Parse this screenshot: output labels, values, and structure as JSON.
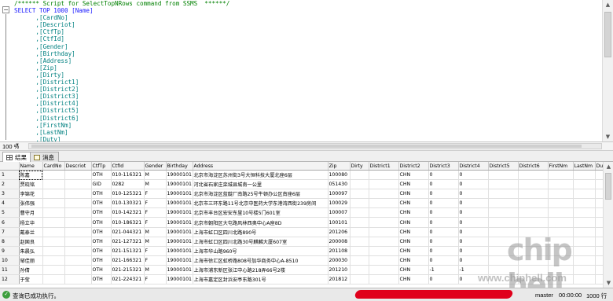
{
  "editor": {
    "lines": [
      {
        "t": "/****** Script for SelectTopNRows command from SSMS  ******/",
        "c": "comment"
      },
      {
        "t": "SELECT TOP 1000 [Name]",
        "c": "kw"
      },
      {
        "t": "      ,[CardNo]",
        "c": "col"
      },
      {
        "t": "      ,[Descriot]",
        "c": "col"
      },
      {
        "t": "      ,[CtfTp]",
        "c": "col"
      },
      {
        "t": "      ,[CtfId]",
        "c": "col"
      },
      {
        "t": "      ,[Gender]",
        "c": "col"
      },
      {
        "t": "      ,[Birthday]",
        "c": "col"
      },
      {
        "t": "      ,[Address]",
        "c": "col"
      },
      {
        "t": "      ,[Zip]",
        "c": "col"
      },
      {
        "t": "      ,[Dirty]",
        "c": "col"
      },
      {
        "t": "      ,[District1]",
        "c": "col"
      },
      {
        "t": "      ,[District2]",
        "c": "col"
      },
      {
        "t": "      ,[District3]",
        "c": "col"
      },
      {
        "t": "      ,[District4]",
        "c": "col"
      },
      {
        "t": "      ,[District5]",
        "c": "col"
      },
      {
        "t": "      ,[District6]",
        "c": "col"
      },
      {
        "t": "      ,[FirstNm]",
        "c": "col"
      },
      {
        "t": "      ,[LastNm]",
        "c": "col"
      },
      {
        "t": "      ,[Duty]",
        "c": "col"
      }
    ]
  },
  "zoom": {
    "value": "100 %"
  },
  "tabs": [
    {
      "label": "结果",
      "icon": "grid-icon",
      "active": true
    },
    {
      "label": "消息",
      "icon": "message-icon",
      "active": false
    }
  ],
  "grid": {
    "columns": [
      "",
      "Name",
      "CardNo",
      "Descriot",
      "CtfTp",
      "CtfId",
      "Gender",
      "Birthday",
      "Address",
      "Zip",
      "Dirty",
      "District1",
      "District2",
      "District3",
      "District4",
      "District5",
      "District6",
      "FirstNm",
      "LastNm",
      "Duty"
    ],
    "rows": [
      [
        "1",
        "陈嘉",
        "",
        "",
        "OTH",
        "010-116321",
        "M",
        "19000101",
        "北京市海淀区苏州街3号大恒科技大厦北座6层",
        "100080",
        "",
        "",
        "CHN",
        "0",
        "0",
        "",
        "",
        "",
        "",
        ""
      ],
      [
        "2",
        "贾晓铭",
        "",
        "",
        "GID",
        "0282",
        "M",
        "19000101",
        "河北省石家庄栾城县城南一公里",
        "051430",
        "",
        "",
        "CHN",
        "0",
        "0",
        "",
        "",
        "",
        "",
        ""
      ],
      [
        "3",
        "李锦花",
        "",
        "",
        "OTH",
        "010-125321",
        "F",
        "19000101",
        "北京市海淀区蓝靛厂南路25号牛顿办公区南座6层",
        "100097",
        "",
        "",
        "CHN",
        "0",
        "0",
        "",
        "",
        "",
        "",
        ""
      ],
      [
        "4",
        "张伟强",
        "",
        "",
        "OTH",
        "010-130321",
        "F",
        "19000101",
        "北京市三环东路11号北京中医药大学东港湾西街239房间",
        "100029",
        "",
        "",
        "CHN",
        "0",
        "0",
        "",
        "",
        "",
        "",
        ""
      ],
      [
        "5",
        "曹守月",
        "",
        "",
        "OTH",
        "010-142321",
        "F",
        "19000101",
        "北京市丰台区宏安东里10号楼5门601室",
        "100007",
        "",
        "",
        "CHN",
        "0",
        "0",
        "",
        "",
        "",
        "",
        ""
      ],
      [
        "6",
        "杨立华",
        "",
        "",
        "OTH",
        "010-186321",
        "F",
        "19000101",
        "北京市朝阳区大屯路风林西奥中心A座8D",
        "100101",
        "",
        "",
        "CHN",
        "0",
        "0",
        "",
        "",
        "",
        "",
        ""
      ],
      [
        "7",
        "戴泰兰",
        "",
        "",
        "OTH",
        "021-044321",
        "M",
        "19000101",
        "上海市虹口区四川北路890号",
        "201206",
        "",
        "",
        "CHN",
        "0",
        "0",
        "",
        "",
        "",
        "",
        ""
      ],
      [
        "8",
        "赵国良",
        "",
        "",
        "OTH",
        "021-127321",
        "M",
        "19000101",
        "上海市虹口区四川北路30号麒麟大厦607室",
        "200008",
        "",
        "",
        "CHN",
        "0",
        "0",
        "",
        "",
        "",
        "",
        ""
      ],
      [
        "9",
        "朱晨弘",
        "",
        "",
        "OTH",
        "021-151321",
        "F",
        "19000101",
        "上海市华山路960号",
        "201108",
        "",
        "",
        "CHN",
        "0",
        "0",
        "",
        "",
        "",
        "",
        ""
      ],
      [
        "10",
        "邹佳丽",
        "",
        "",
        "OTH",
        "021-166321",
        "F",
        "19000101",
        "上海市徐汇区虹桥路808号加华商务中心A-8510",
        "200030",
        "",
        "",
        "CHN",
        "0",
        "0",
        "",
        "",
        "",
        "",
        ""
      ],
      [
        "11",
        "孙倩",
        "",
        "",
        "OTH",
        "021-215321",
        "M",
        "19000101",
        "上海市浦东新区张江中心路218弄66号2楼",
        "201210",
        "",
        "",
        "CHN",
        "-1",
        "-1",
        "",
        "",
        "",
        "",
        ""
      ],
      [
        "12",
        "于莹",
        "",
        "",
        "OTH",
        "021-224321",
        "F",
        "19000101",
        "上海市嘉定区封浜安亭东路301号",
        "201812",
        "",
        "",
        "CHN",
        "0",
        "0",
        "",
        "",
        "",
        "",
        ""
      ]
    ]
  },
  "status": {
    "text": "查询已成功执行。",
    "db": "master",
    "time": "00:00:00",
    "rows": "1000 行"
  },
  "watermark": {
    "logo": "chip hell",
    "url": "www.chiphell.com"
  }
}
